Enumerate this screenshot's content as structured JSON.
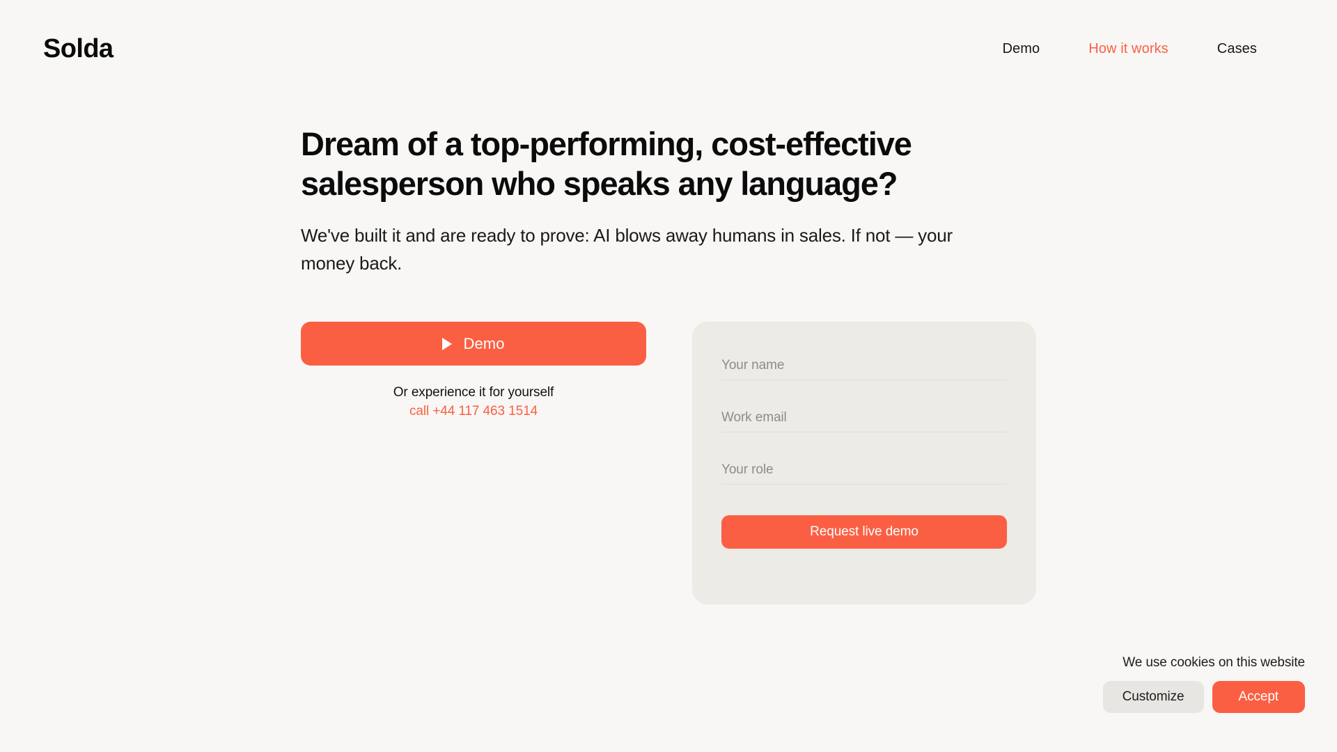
{
  "theme": {
    "background": "#f8f7f5",
    "accent": "#fb5f43",
    "card_background": "#edebe6",
    "text": "#111111",
    "muted_text": "#8d8c88",
    "secondary_button": "#e8e6e2"
  },
  "header": {
    "logo": "Solda",
    "nav": [
      {
        "label": "Demo",
        "accent": false
      },
      {
        "label": "How it works",
        "accent": true
      },
      {
        "label": "Cases",
        "accent": false
      }
    ]
  },
  "hero": {
    "title": "Dream of a top-performing, cost-effective salesperson who speaks any language?",
    "subtitle": "We've built it and are ready to prove: AI blows away humans in sales. If not — your money back.",
    "demo_button": {
      "label": "Demo",
      "icon": "play-icon"
    },
    "experience_note": "Or experience it for yourself",
    "phone_link": "call +44 117 463 1514"
  },
  "form": {
    "fields": [
      {
        "name": "name",
        "placeholder": "Your name",
        "value": ""
      },
      {
        "name": "email",
        "placeholder": "Work email",
        "value": ""
      },
      {
        "name": "role",
        "placeholder": "Your role",
        "value": ""
      }
    ],
    "submit_label": "Request live demo"
  },
  "cookies": {
    "message": "We use cookies on this website",
    "customize_label": "Customize",
    "accept_label": "Accept"
  }
}
